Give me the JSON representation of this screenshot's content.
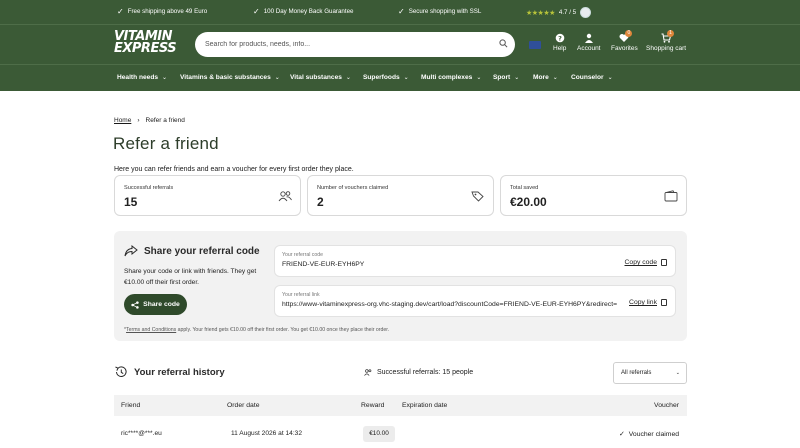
{
  "topbar": {
    "usp1": "Free shipping above 49 Euro",
    "usp2": "100 Day Money Back Guarantee",
    "usp3": "Secure shopping with SSL",
    "rating": "4.7 / 5",
    "stars": "★★★★★",
    "colors": {
      "bg": "#3b5a36",
      "stars": "#b7c33a"
    }
  },
  "header": {
    "logo_line1": "VITAMIN",
    "logo_line2": "EXPRESS",
    "search_placeholder": "Search for products, needs, info...",
    "help": "Help",
    "account": "Account",
    "favorites": "Favorites",
    "favorites_count": "0",
    "cart": "Shopping cart",
    "cart_count": "1"
  },
  "nav": {
    "items": [
      "Health needs",
      "Vitamins & basic substances",
      "Vital substances",
      "Superfoods",
      "Multi complexes",
      "Sport",
      "More",
      "Counselor"
    ]
  },
  "breadcrumb": {
    "home": "Home",
    "current": "Refer a friend"
  },
  "page": {
    "title": "Refer a friend",
    "intro": "Here you can refer friends and earn a voucher for every first order they place."
  },
  "stats": [
    {
      "label": "Successful referrals",
      "value": "15",
      "icon": "people-icon"
    },
    {
      "label": "Number of vouchers claimed",
      "value": "2",
      "icon": "tag-icon"
    },
    {
      "label": "Total saved",
      "value": "€20.00",
      "icon": "wallet-icon"
    }
  ],
  "share": {
    "heading": "Share your referral code",
    "desc": "Share your code or link with friends. They get €10.00 off their first order.",
    "button": "Share code",
    "code_label": "Your referral code",
    "code_value": "FRIEND-VE-EUR-EYH6PY",
    "copy_code": "Copy code",
    "link_label": "Your referral link",
    "link_value": "https://www-vitaminexpress-org.vhc-staging.dev/cart/load?discountCode=FRIEND-VE-EUR-EYH6PY&redirect=",
    "copy_link": "Copy link",
    "fine_star": "*",
    "fine_link": "Terms and Conditions",
    "fine_rest": " apply. Your friend gets €10.00 off their first order. You get €10.00 once they place their order."
  },
  "history": {
    "heading": "Your referral history",
    "successful": "Successful referrals: 15 people",
    "filter": "All referrals",
    "columns": {
      "friend": "Friend",
      "order_date": "Order date",
      "reward": "Reward",
      "expiration": "Expiration date",
      "voucher": "Voucher"
    },
    "rows": [
      {
        "friend": "ric****@***.eu",
        "order_date": "11 August 2026 at 14:32",
        "reward": "€10.00",
        "expiration": "",
        "voucher": "Voucher claimed"
      }
    ]
  }
}
